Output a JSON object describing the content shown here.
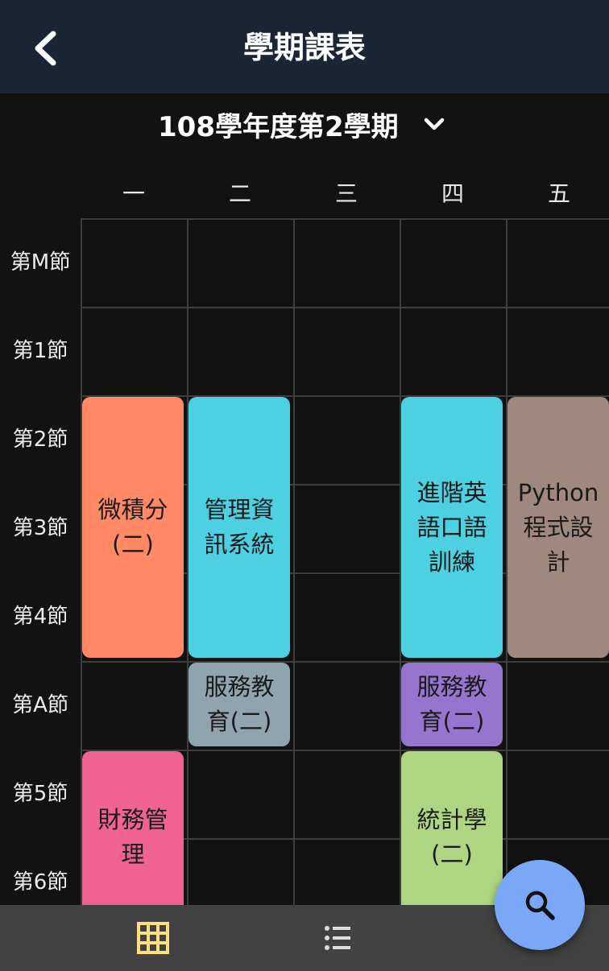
{
  "app_bar": {
    "title": "學期課表",
    "back_icon": "chevron-left-icon"
  },
  "semester_selector": {
    "label": "108學年度第2學期",
    "icon": "chevron-down-icon"
  },
  "days": [
    "一",
    "二",
    "三",
    "四",
    "五"
  ],
  "periods": [
    "第M節",
    "第1節",
    "第2節",
    "第3節",
    "第4節",
    "第A節",
    "第5節",
    "第6節"
  ],
  "courses": [
    {
      "name": "微積分(二)",
      "lines": [
        "微積分",
        "(二)"
      ],
      "color": "#ff8a65",
      "day": "一",
      "periods": [
        "第2節",
        "第3節",
        "第4節"
      ]
    },
    {
      "name": "管理資訊系統",
      "lines": [
        "管理資",
        "訊系統"
      ],
      "color": "#4dd0e1",
      "day": "二",
      "periods": [
        "第2節",
        "第3節",
        "第4節"
      ]
    },
    {
      "name": "進階英語口語訓練",
      "lines": [
        "進階英",
        "語口語",
        "訓練"
      ],
      "color": "#4dd0e1",
      "day": "四",
      "periods": [
        "第2節",
        "第3節",
        "第4節"
      ]
    },
    {
      "name": "Python程式設計",
      "lines": [
        "Python",
        "程式設",
        "計"
      ],
      "color": "#a1887f",
      "day": "五",
      "periods": [
        "第2節",
        "第3節",
        "第4節"
      ]
    },
    {
      "name": "服務教育(二)",
      "lines": [
        "服務教",
        "育(二)"
      ],
      "color": "#90a4ae",
      "day": "二",
      "periods": [
        "第A節"
      ]
    },
    {
      "name": "服務教育(二)",
      "lines": [
        "服務教",
        "育(二)"
      ],
      "color": "#9575cd",
      "day": "四",
      "periods": [
        "第A節"
      ]
    },
    {
      "name": "財務管理",
      "lines": [
        "財務管",
        "理"
      ],
      "color": "#f06292",
      "day": "一",
      "periods": [
        "第5節",
        "第6節"
      ]
    },
    {
      "name": "統計學(二)",
      "lines": [
        "統計學",
        "(二)"
      ],
      "color": "#aed581",
      "day": "四",
      "periods": [
        "第5節",
        "第6節"
      ]
    }
  ],
  "bottom_nav": {
    "items": [
      {
        "name": "grid-view",
        "icon": "grid-icon",
        "active": true,
        "color": "#ffe082"
      },
      {
        "name": "list-view",
        "icon": "list-icon",
        "active": false,
        "color": "#dddddd"
      }
    ]
  },
  "fab": {
    "icon": "search-icon",
    "color": "#7aa8f7"
  }
}
